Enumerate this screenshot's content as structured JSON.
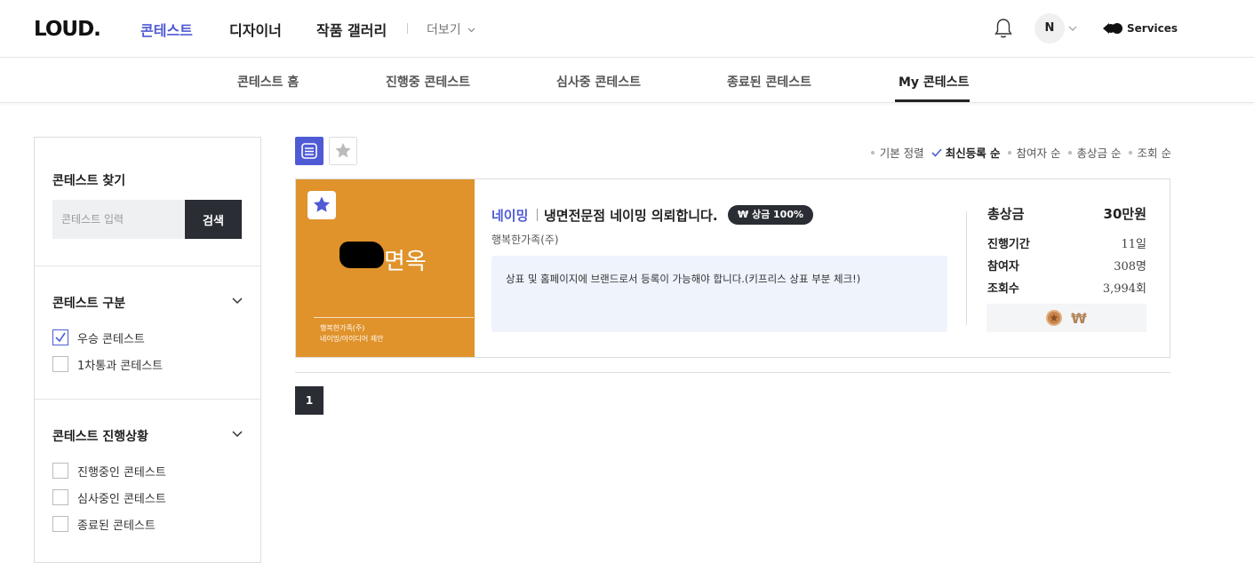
{
  "header": {
    "logo": "LOUD.",
    "nav": [
      {
        "label": "콘테스트",
        "active": true
      },
      {
        "label": "디자이너",
        "active": false
      },
      {
        "label": "작품 갤러리",
        "active": false
      }
    ],
    "more": "더보기",
    "avatar_initial": "N",
    "services_label": "Services"
  },
  "subnav": {
    "items": [
      "콘테스트 홈",
      "진행중 콘테스트",
      "심사중 콘테스트",
      "종료된 콘테스트",
      "My 콘테스트"
    ],
    "active": "My 콘테스트"
  },
  "sidebar": {
    "search": {
      "title": "콘테스트 찾기",
      "placeholder": "콘테스트 입력",
      "button": "검색"
    },
    "category": {
      "title": "콘테스트 구분",
      "options": [
        {
          "label": "우승 콘테스트",
          "checked": true
        },
        {
          "label": "1차통과 콘테스트",
          "checked": false
        }
      ]
    },
    "status": {
      "title": "콘테스트 진행상황",
      "options": [
        {
          "label": "진행중인 콘테스트",
          "checked": false
        },
        {
          "label": "심사중인 콘테스트",
          "checked": false
        },
        {
          "label": "종료된 콘테스트",
          "checked": false
        }
      ]
    }
  },
  "sort": {
    "options": [
      "기본 정렬",
      "최신등록 순",
      "참여자 순",
      "총상금 순",
      "조회 순"
    ],
    "active": "최신등록 순"
  },
  "contest": {
    "thumb_title": "면옥",
    "thumb_company": "행복한가족(주)",
    "thumb_subtitle": "네이밍/아이디어 제안",
    "category": "네이밍",
    "title": "냉면전문점 네이밍 의뢰합니다.",
    "badge": "₩ 상금 100%",
    "company": "행복한가족(주)",
    "description": "상표 및 홈페이지에 브랜드로서 등록이 가능해야 합니다.(키프리스 상표 부분 체크!)",
    "total_label": "총상금",
    "total_value": "30만원",
    "stats": [
      {
        "label": "진행기간",
        "value": "11일"
      },
      {
        "label": "참여자",
        "value": "308명"
      },
      {
        "label": "조회수",
        "value": "3,994회"
      }
    ],
    "reward_symbol": "₩"
  },
  "pagination": {
    "current": "1"
  },
  "colors": {
    "accent": "#4f5bd5",
    "dark": "#2a2d34",
    "thumb": "#e0922b"
  }
}
